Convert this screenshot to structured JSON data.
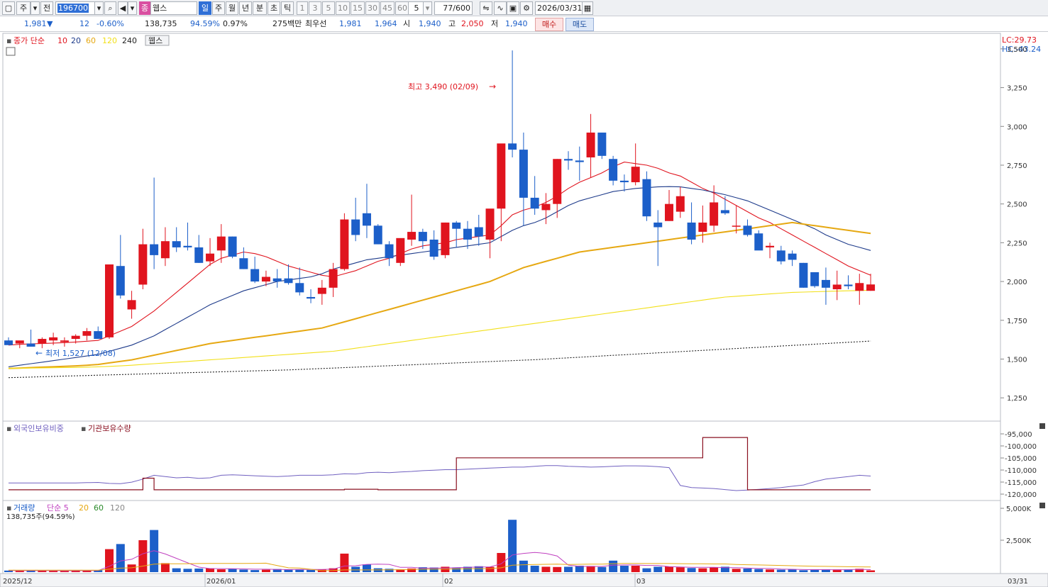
{
  "toolbar": {
    "market_label": "주",
    "prev_label": "전",
    "code": "196700",
    "stock_icon_label": "종",
    "stock_name": "웹스",
    "periods": [
      "일",
      "주",
      "월",
      "년",
      "분",
      "초",
      "틱"
    ],
    "selected_period": "일",
    "intervals": [
      "1",
      "3",
      "5",
      "10",
      "15",
      "30",
      "45",
      "60"
    ],
    "interval_value": "5",
    "count": "77",
    "count_total": "/600",
    "date": "2026/03/31"
  },
  "quote": {
    "price": "1,981",
    "direction": "▼",
    "change": "12",
    "change_pct": "-0.60%",
    "volume": "138,735",
    "volume_ratio": "94.59%",
    "turnover_ratio": "0.97%",
    "trade_value": "275백만",
    "best_label": "최우선",
    "best_ask": "1,981",
    "best_bid": "1,964",
    "open_label": "시",
    "open": "1,940",
    "high_label": "고",
    "high": "2,050",
    "low_label": "저",
    "low": "1,940",
    "buy_label": "매수",
    "sell_label": "매도"
  },
  "price_panel": {
    "legend_prefix": "종가 단순",
    "ma_labels": [
      "10",
      "20",
      "60",
      "120",
      "240"
    ],
    "ma_colors": [
      "#e0141e",
      "#1d3a8a",
      "#e6a812",
      "#f2e01a",
      "#222222"
    ],
    "stock_tag": "웹스",
    "lc": "LC:29.73",
    "hc": "HC:-43.24",
    "high_annotation": "최고 3,490 (02/09)",
    "low_annotation": "최저 1,527 (12/08)",
    "y_ticks": [
      "3,500",
      "3,250",
      "3,000",
      "2,750",
      "2,500",
      "2,250",
      "2,000",
      "1,750",
      "1,500",
      "1,250"
    ]
  },
  "holding_panel": {
    "legend1": "외국인보유비중",
    "legend2": "기관보유수량",
    "y_ticks": [
      "-95,000",
      "-100,000",
      "-105,000",
      "-110,000",
      "-115,000",
      "-120,000"
    ]
  },
  "volume_panel": {
    "legend_prefix": "거래량",
    "legend_ma": "단순 5",
    "ma_labels": [
      "20",
      "60",
      "120"
    ],
    "sub_label": "138,735주(94.59%)",
    "y_ticks": [
      "5,000K",
      "2,500K"
    ]
  },
  "x_axis": {
    "labels": [
      "2025/12",
      "2026/01",
      "02",
      "03"
    ],
    "end_label": "03/31"
  },
  "colors": {
    "up": "#e0141e",
    "down": "#1c5fc9",
    "foreign": "#7060c0",
    "institution": "#8a1020"
  },
  "chart_data": {
    "type": "candlestick",
    "ylim": [
      1100,
      3600
    ],
    "candles": [
      [
        1620,
        1640,
        1590,
        1590
      ],
      [
        1600,
        1610,
        1570,
        1620
      ],
      [
        1600,
        1690,
        1580,
        1580
      ],
      [
        1600,
        1640,
        1570,
        1630
      ],
      [
        1620,
        1670,
        1590,
        1640
      ],
      [
        1610,
        1640,
        1580,
        1620
      ],
      [
        1630,
        1660,
        1600,
        1650
      ],
      [
        1650,
        1700,
        1620,
        1680
      ],
      [
        1680,
        1710,
        1640,
        1630
      ],
      [
        1640,
        2110,
        1630,
        2110
      ],
      [
        2100,
        2300,
        1890,
        1910
      ],
      [
        1820,
        1940,
        1760,
        1880
      ],
      [
        1980,
        2340,
        1950,
        2240
      ],
      [
        2240,
        2670,
        2080,
        2170
      ],
      [
        2150,
        2350,
        2100,
        2260
      ],
      [
        2260,
        2350,
        2190,
        2220
      ],
      [
        2230,
        2380,
        2200,
        2220
      ],
      [
        2220,
        2300,
        2120,
        2120
      ],
      [
        2130,
        2280,
        2100,
        2180
      ],
      [
        2200,
        2370,
        2120,
        2290
      ],
      [
        2290,
        2290,
        2150,
        2160
      ],
      [
        2150,
        2220,
        2080,
        2080
      ],
      [
        2080,
        2160,
        1990,
        2000
      ],
      [
        2000,
        2070,
        1970,
        2030
      ],
      [
        2020,
        2080,
        1960,
        2000
      ],
      [
        2020,
        2110,
        1980,
        1990
      ],
      [
        1990,
        2090,
        1910,
        1930
      ],
      [
        1900,
        1950,
        1860,
        1890
      ],
      [
        1920,
        2010,
        1850,
        1960
      ],
      [
        1960,
        2120,
        1900,
        2080
      ],
      [
        2080,
        2440,
        2070,
        2400
      ],
      [
        2400,
        2540,
        2260,
        2300
      ],
      [
        2440,
        2630,
        2280,
        2360
      ],
      [
        2360,
        2370,
        2240,
        2240
      ],
      [
        2240,
        2260,
        2100,
        2150
      ],
      [
        2120,
        2270,
        2100,
        2280
      ],
      [
        2270,
        2560,
        2230,
        2320
      ],
      [
        2320,
        2340,
        2210,
        2260
      ],
      [
        2270,
        2330,
        2140,
        2160
      ],
      [
        2170,
        2380,
        2150,
        2380
      ],
      [
        2380,
        2390,
        2220,
        2340
      ],
      [
        2340,
        2390,
        2210,
        2270
      ],
      [
        2350,
        2430,
        2230,
        2290
      ],
      [
        2270,
        2390,
        2150,
        2470
      ],
      [
        2470,
        2770,
        2260,
        2890
      ],
      [
        2890,
        3490,
        2800,
        2850
      ],
      [
        2850,
        2960,
        2360,
        2540
      ],
      [
        2540,
        2680,
        2430,
        2470
      ],
      [
        2460,
        2570,
        2370,
        2500
      ],
      [
        2500,
        2790,
        2410,
        2790
      ],
      [
        2790,
        2840,
        2720,
        2780
      ],
      [
        2780,
        2870,
        2650,
        2770
      ],
      [
        2800,
        3080,
        2670,
        2960
      ],
      [
        2960,
        2960,
        2790,
        2810
      ],
      [
        2790,
        2810,
        2620,
        2650
      ],
      [
        2650,
        2690,
        2580,
        2640
      ],
      [
        2640,
        2890,
        2620,
        2740
      ],
      [
        2660,
        2710,
        2390,
        2420
      ],
      [
        2380,
        2460,
        2100,
        2350
      ],
      [
        2390,
        2590,
        2390,
        2500
      ],
      [
        2450,
        2610,
        2410,
        2550
      ],
      [
        2380,
        2510,
        2240,
        2270
      ],
      [
        2320,
        2490,
        2250,
        2380
      ],
      [
        2360,
        2620,
        2320,
        2510
      ],
      [
        2460,
        2550,
        2430,
        2440
      ],
      [
        2360,
        2490,
        2310,
        2360
      ],
      [
        2360,
        2400,
        2290,
        2300
      ],
      [
        2310,
        2330,
        2220,
        2200
      ],
      [
        2220,
        2250,
        2150,
        2230
      ],
      [
        2200,
        2230,
        2110,
        2130
      ],
      [
        2180,
        2200,
        2100,
        2140
      ],
      [
        2120,
        2120,
        1960,
        1960
      ],
      [
        2060,
        2060,
        1960,
        1970
      ],
      [
        2010,
        2090,
        1850,
        1960
      ],
      [
        1950,
        2070,
        1880,
        1980
      ],
      [
        1980,
        2040,
        1950,
        1970
      ],
      [
        1940,
        2050,
        1850,
        1990
      ],
      [
        1940,
        2050,
        1940,
        1981
      ]
    ],
    "ma_series": [
      {
        "name": "10",
        "color": "#e0141e",
        "values": [
          1590,
          1595,
          1598,
          1600,
          1603,
          1606,
          1610,
          1615,
          1620,
          1650,
          1680,
          1710,
          1760,
          1810,
          1870,
          1930,
          1990,
          2050,
          2110,
          2150,
          2170,
          2190,
          2180,
          2160,
          2130,
          2100,
          2080,
          2060,
          2040,
          2030,
          2050,
          2070,
          2100,
          2130,
          2150,
          2180,
          2210,
          2230,
          2240,
          2250,
          2270,
          2280,
          2290,
          2300,
          2360,
          2430,
          2460,
          2480,
          2510,
          2550,
          2600,
          2640,
          2670,
          2700,
          2740,
          2770,
          2760,
          2750,
          2730,
          2700,
          2680,
          2640,
          2600,
          2570,
          2530,
          2490,
          2450,
          2410,
          2380,
          2340,
          2300,
          2260,
          2220,
          2180,
          2140,
          2100,
          2070,
          2040
        ]
      },
      {
        "name": "20",
        "color": "#1d3a8a",
        "values": [
          1450,
          1460,
          1470,
          1480,
          1490,
          1500,
          1510,
          1520,
          1530,
          1550,
          1570,
          1590,
          1620,
          1650,
          1690,
          1730,
          1770,
          1810,
          1850,
          1880,
          1910,
          1940,
          1960,
          1980,
          2000,
          2010,
          2020,
          2030,
          2050,
          2080,
          2100,
          2120,
          2140,
          2150,
          2160,
          2170,
          2180,
          2190,
          2200,
          2210,
          2220,
          2230,
          2240,
          2250,
          2290,
          2330,
          2360,
          2380,
          2410,
          2450,
          2490,
          2520,
          2540,
          2560,
          2580,
          2590,
          2600,
          2605,
          2610,
          2612,
          2610,
          2600,
          2590,
          2575,
          2560,
          2540,
          2520,
          2490,
          2460,
          2430,
          2400,
          2370,
          2340,
          2300,
          2270,
          2240,
          2220,
          2200
        ]
      },
      {
        "name": "60",
        "color": "#e6a812",
        "values": [
          1440,
          1442,
          1445,
          1448,
          1450,
          1453,
          1456,
          1460,
          1465,
          1475,
          1485,
          1495,
          1510,
          1525,
          1540,
          1555,
          1570,
          1585,
          1600,
          1610,
          1620,
          1630,
          1640,
          1650,
          1660,
          1670,
          1680,
          1690,
          1700,
          1720,
          1740,
          1760,
          1780,
          1800,
          1820,
          1840,
          1860,
          1880,
          1900,
          1920,
          1940,
          1960,
          1980,
          2000,
          2030,
          2060,
          2090,
          2110,
          2130,
          2150,
          2170,
          2190,
          2200,
          2210,
          2220,
          2230,
          2240,
          2250,
          2260,
          2270,
          2280,
          2290,
          2300,
          2310,
          2320,
          2330,
          2340,
          2350,
          2360,
          2370,
          2380,
          2370,
          2360,
          2350,
          2340,
          2330,
          2320,
          2310
        ]
      },
      {
        "name": "120",
        "color": "#f2e01a",
        "values": [
          1440,
          1441,
          1442,
          1443,
          1444,
          1445,
          1446,
          1448,
          1450,
          1453,
          1456,
          1460,
          1465,
          1470,
          1475,
          1480,
          1485,
          1490,
          1495,
          1500,
          1505,
          1510,
          1515,
          1520,
          1525,
          1530,
          1535,
          1540,
          1545,
          1550,
          1560,
          1570,
          1580,
          1590,
          1600,
          1610,
          1620,
          1630,
          1640,
          1650,
          1660,
          1670,
          1680,
          1690,
          1700,
          1710,
          1720,
          1730,
          1740,
          1750,
          1760,
          1770,
          1780,
          1790,
          1800,
          1810,
          1820,
          1830,
          1840,
          1850,
          1860,
          1870,
          1880,
          1890,
          1900,
          1905,
          1910,
          1915,
          1920,
          1925,
          1930,
          1932,
          1934,
          1936,
          1938,
          1940,
          1942,
          1944
        ]
      },
      {
        "name": "240",
        "color": "#222222",
        "values": [
          1380,
          1382,
          1384,
          1386,
          1388,
          1390,
          1392,
          1394,
          1396,
          1398,
          1400,
          1402,
          1404,
          1406,
          1408,
          1410,
          1412,
          1414,
          1416,
          1418,
          1420,
          1422,
          1424,
          1426,
          1428,
          1430,
          1433,
          1436,
          1439,
          1442,
          1445,
          1448,
          1451,
          1454,
          1457,
          1460,
          1463,
          1466,
          1469,
          1472,
          1475,
          1478,
          1481,
          1484,
          1487,
          1490,
          1493,
          1496,
          1500,
          1504,
          1508,
          1512,
          1516,
          1520,
          1524,
          1528,
          1532,
          1536,
          1540,
          1544,
          1548,
          1552,
          1556,
          1560,
          1564,
          1568,
          1572,
          1576,
          1580,
          1584,
          1588,
          1592,
          1596,
          1600,
          1604,
          1608,
          1612,
          1616
        ]
      }
    ],
    "foreign_ratio": [
      0.3,
      0.3,
      0.3,
      0.3,
      0.3,
      0.3,
      0.3,
      0.31,
      0.32,
      0.28,
      0.27,
      0.33,
      0.45,
      0.6,
      0.55,
      0.5,
      0.52,
      0.48,
      0.5,
      0.6,
      0.62,
      0.6,
      0.58,
      0.56,
      0.55,
      0.57,
      0.6,
      0.6,
      0.6,
      0.62,
      0.66,
      0.65,
      0.7,
      0.72,
      0.7,
      0.73,
      0.75,
      0.78,
      0.8,
      0.82,
      0.82,
      0.84,
      0.86,
      0.88,
      0.9,
      0.92,
      0.92,
      0.95,
      0.98,
      0.98,
      0.95,
      0.94,
      0.92,
      0.93,
      0.95,
      0.97,
      0.97,
      0.96,
      0.94,
      0.9,
      0.2,
      0.12,
      0.1,
      0.08,
      0.04,
      0,
      0.02,
      0.05,
      0.08,
      0.12,
      0.17,
      0.22,
      0.35,
      0.45,
      0.5,
      0.55,
      0.6,
      0.57
    ],
    "institution_qty": [
      0.05,
      0.05,
      0.05,
      0.05,
      0.05,
      0.05,
      0.05,
      0.05,
      0.05,
      0.05,
      0.05,
      0.05,
      0.25,
      0.05,
      0.05,
      0.05,
      0.05,
      0.05,
      0.05,
      0.05,
      0.05,
      0.05,
      0.05,
      0.05,
      0.05,
      0.05,
      0.05,
      0.05,
      0.05,
      0.05,
      0.06,
      0.06,
      0.06,
      0.05,
      0.05,
      0.05,
      0.05,
      0.05,
      0.05,
      0.05,
      0.6,
      0.6,
      0.6,
      0.6,
      0.6,
      0.6,
      0.6,
      0.6,
      0.6,
      0.6,
      0.6,
      0.6,
      0.6,
      0.6,
      0.6,
      0.6,
      0.6,
      0.6,
      0.6,
      0.6,
      0.6,
      0.6,
      0.95,
      0.95,
      0.95,
      0.95,
      0.05,
      0.05,
      0.05,
      0.05,
      0.05,
      0.05,
      0.05,
      0.05,
      0.05,
      0.05,
      0.05,
      0.05
    ],
    "volume_k": [
      120,
      100,
      110,
      140,
      100,
      90,
      120,
      130,
      160,
      1800,
      2200,
      600,
      2500,
      3300,
      700,
      300,
      260,
      280,
      300,
      220,
      260,
      200,
      160,
      190,
      240,
      200,
      220,
      170,
      220,
      300,
      1450,
      420,
      600,
      300,
      260,
      220,
      280,
      380,
      360,
      420,
      360,
      420,
      460,
      410,
      1500,
      4100,
      900,
      500,
      420,
      400,
      420,
      500,
      480,
      400,
      900,
      500,
      500,
      300,
      420,
      440,
      380,
      320,
      300,
      360,
      420,
      260,
      280,
      240,
      210,
      190,
      220,
      150,
      190,
      220,
      210,
      210,
      260,
      139
    ],
    "volume_ma5": [
      120,
      116,
      114,
      118,
      114,
      108,
      112,
      118,
      120,
      454,
      876,
      1006,
      1440,
      1680,
      1420,
      1080,
      730,
      390,
      280,
      272,
      264,
      252,
      228,
      226,
      210,
      200,
      206,
      204,
      210,
      232,
      478,
      498,
      608,
      624,
      606,
      374,
      372,
      306,
      324,
      324,
      352,
      368,
      404,
      410,
      650,
      1342,
      1464,
      1542,
      1464,
      1264,
      548,
      448,
      444,
      444,
      544,
      560,
      560,
      520,
      524,
      432,
      408,
      372,
      374,
      376,
      352,
      342,
      316,
      286,
      282,
      240,
      220,
      198,
      194,
      194,
      186,
      196,
      218,
      194
    ],
    "volume_ma20": [
      150,
      150,
      150,
      150,
      150,
      150,
      150,
      150,
      150,
      230,
      310,
      340,
      470,
      630,
      650,
      650,
      660,
      670,
      680,
      680,
      680,
      680,
      690,
      700,
      510,
      340,
      320,
      220,
      110,
      130,
      170,
      170,
      170,
      170,
      180,
      190,
      200,
      220,
      230,
      240,
      250,
      260,
      270,
      280,
      340,
      540,
      580,
      600,
      610,
      620,
      600,
      610,
      620,
      620,
      660,
      680,
      680,
      670,
      670,
      670,
      660,
      650,
      650,
      640,
      640,
      600,
      580,
      560,
      540,
      520,
      500,
      480,
      460,
      450,
      440,
      420,
      410,
      400
    ]
  }
}
